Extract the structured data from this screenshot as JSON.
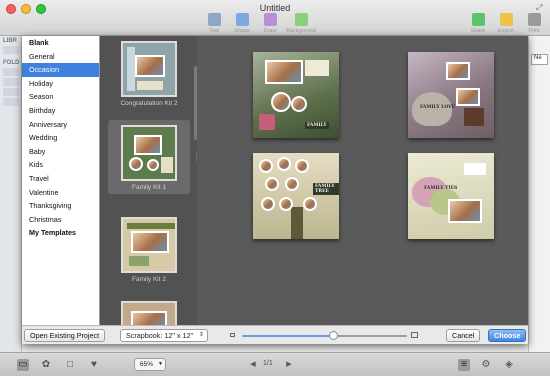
{
  "window": {
    "title": "Untitled"
  },
  "toolbar": {
    "items": [
      {
        "label": "Text",
        "color": "#8ea6c8"
      },
      {
        "label": "Shape",
        "color": "#7fa6e0"
      },
      {
        "label": "Draw",
        "color": "#b98fd6"
      },
      {
        "label": "Background",
        "color": "#8ccf7a"
      }
    ],
    "right_items": [
      {
        "label": "Share",
        "color": "#5cc46b"
      },
      {
        "label": "Export",
        "color": "#f0c24a"
      },
      {
        "label": "Print",
        "color": "#9a9a9a"
      }
    ]
  },
  "library": {
    "header_library": "LIBR",
    "header_folders": "FOLD"
  },
  "categories": [
    {
      "label": "Blank",
      "bold": true
    },
    {
      "label": "General"
    },
    {
      "label": "Occasion",
      "selected": true
    },
    {
      "label": "Holiday"
    },
    {
      "label": "Season"
    },
    {
      "label": "Birthday"
    },
    {
      "label": "Anniversary"
    },
    {
      "label": "Wedding"
    },
    {
      "label": "Baby"
    },
    {
      "label": "Kids"
    },
    {
      "label": "Travel"
    },
    {
      "label": "Valentine"
    },
    {
      "label": "Thanksgiving"
    },
    {
      "label": "Christmas"
    },
    {
      "label": "My Templates",
      "bold": true
    }
  ],
  "kits": [
    {
      "label": "Congratulation Kit 2"
    },
    {
      "label": "Family Kit 1",
      "selected": true
    },
    {
      "label": "Family Kit 2"
    },
    {
      "label": ""
    }
  ],
  "templates": {
    "tag_texts": [
      "FAMILY",
      "FAMILY LOVE",
      "FAMILY TREE",
      "FAMILY TIES"
    ]
  },
  "bottom": {
    "open_button": "Open Existing Project",
    "size_select": "Scrapbook: 12\" x 12\"",
    "zoom_slider_value": 0.55,
    "cancel_button": "Cancel",
    "choose_button": "Choose"
  },
  "statusbar": {
    "zoom": "65%",
    "page_indicator": "1/1"
  }
}
